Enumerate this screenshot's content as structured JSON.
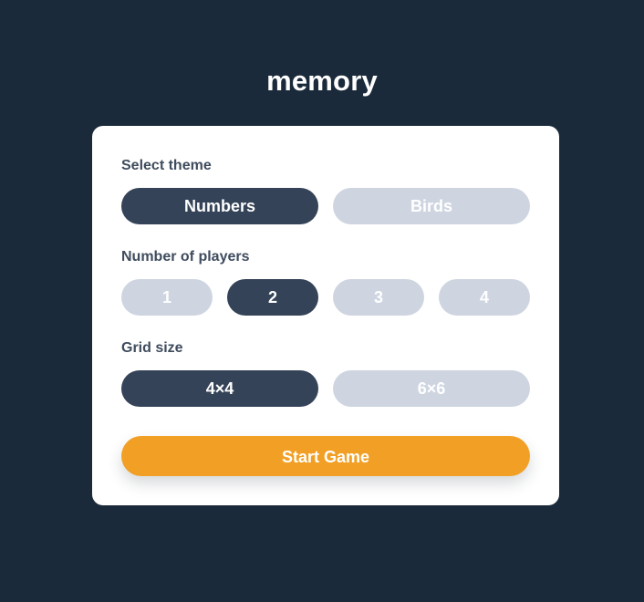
{
  "app": {
    "title": "memory"
  },
  "settings": {
    "theme": {
      "label": "Select theme",
      "options": [
        "Numbers",
        "Birds"
      ],
      "selected": "Numbers"
    },
    "players": {
      "label": "Number of players",
      "options": [
        "1",
        "2",
        "3",
        "4"
      ],
      "selected": "2"
    },
    "grid": {
      "label": "Grid size",
      "options": [
        "4×4",
        "6×6"
      ],
      "selected": "4×4"
    }
  },
  "actions": {
    "start_label": "Start Game"
  },
  "colors": {
    "background": "#1a2a3a",
    "card": "#ffffff",
    "active_pill": "#344357",
    "inactive_pill": "#ced5e1",
    "accent": "#f1a025",
    "label_text": "#3f4c5e"
  }
}
